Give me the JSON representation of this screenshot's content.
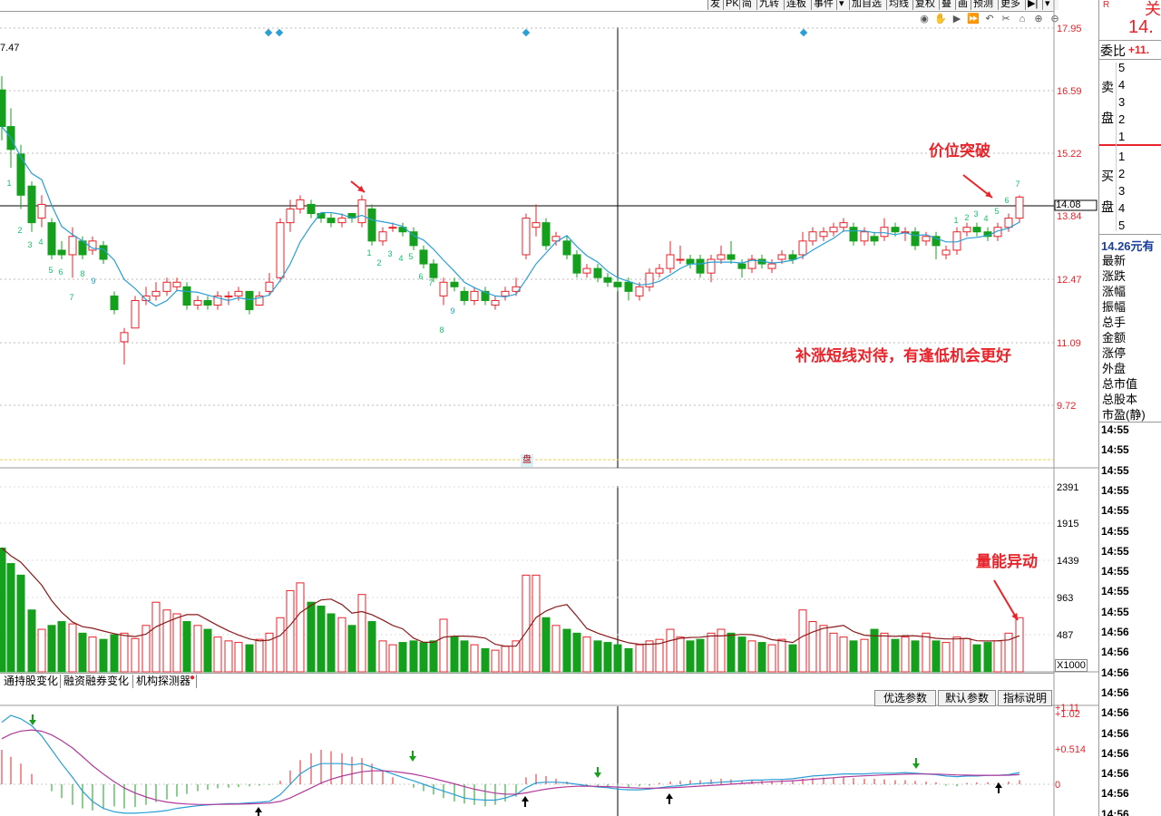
{
  "toolbar": {
    "buttons": [
      "发",
      "PK",
      "简",
      "九转",
      "连板",
      "事件",
      "▾",
      "加自选",
      "均线",
      "复权",
      "叠",
      "画",
      "预测",
      "更多",
      "▶|",
      "▾"
    ]
  },
  "zoom_icons": [
    "eye-icon",
    "hand-icon",
    "play-icon",
    "forward-icon",
    "undo-icon",
    "scissors-icon",
    "lock-icon",
    "zoom-in-icon",
    "zoom-out-icon"
  ],
  "price_panel": {
    "top_label": "7.47",
    "axis_ticks": [
      "17.95",
      "16.59",
      "15.22",
      "13.84",
      "12.47",
      "11.09",
      "9.72"
    ],
    "current_price": "14.08",
    "annotation_breakout": "价位突破",
    "annotation_strategy": "补涨短线对待，有逢低机会更好",
    "cursor_box_label": "盘"
  },
  "volume_panel": {
    "axis_ticks": [
      "2391",
      "1915",
      "1439",
      "963",
      "487"
    ],
    "unit": "X1000",
    "annotation_volume": "量能异动"
  },
  "indicator_tabs": [
    "通持股变化",
    "融资融券变化",
    "机构探测器"
  ],
  "indicator_buttons": [
    "优选参数",
    "默认参数",
    "指标说明"
  ],
  "macd_panel": {
    "axis_ticks": [
      "+1.11",
      "+1.02",
      "+0.514",
      "0"
    ]
  },
  "side_panel": {
    "header_r": "R",
    "header_char": "关",
    "price": "14.",
    "order_ratio_label": "委比",
    "order_ratio_value": "+11.",
    "sell_label_1": "卖",
    "sell_label_2": "盘",
    "buy_label_1": "买",
    "buy_label_2": "盘",
    "sell_levels": [
      "5",
      "4",
      "3",
      "2",
      "1"
    ],
    "buy_levels": [
      "1",
      "2",
      "3",
      "4",
      "5"
    ],
    "unit_price": "14.26元有",
    "stats": [
      "最新",
      "涨跌",
      "涨幅",
      "振幅",
      "总手",
      "金额",
      "涨停",
      "外盘",
      "总市值",
      "总股本",
      "市盈(静)"
    ],
    "times": [
      "14:55",
      "14:55",
      "14:55",
      "14:55",
      "14:55",
      "14:55",
      "14:55",
      "14:55",
      "14:55",
      "14:55",
      "14:56",
      "14:56",
      "14:56",
      "14:56",
      "14:56",
      "14:56",
      "14:56",
      "14:56",
      "14:56",
      "14:56",
      "14:56"
    ]
  },
  "colors": {
    "up": "#e8232a",
    "down": "#14a01c",
    "ma_line": "#2a9fd6",
    "volume_ma": "#8b1a1a",
    "macd_dif": "#2a9fd6",
    "macd_dea": "#b03a9a",
    "nine_turn": "#13c36b"
  }
}
